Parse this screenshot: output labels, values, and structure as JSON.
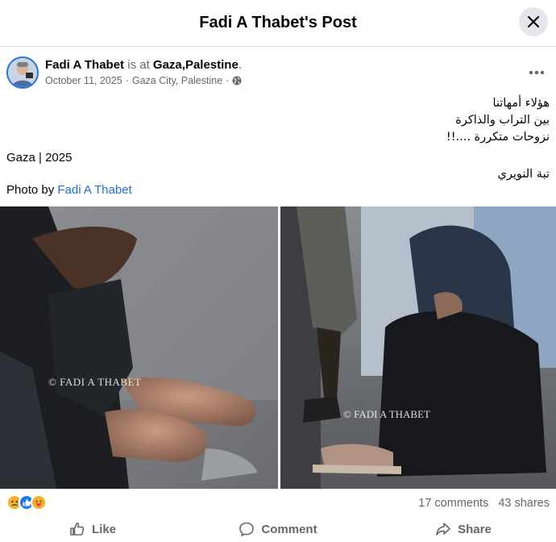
{
  "header": {
    "title": "Fadi A Thabet's Post",
    "close_icon": "close-icon"
  },
  "post": {
    "author": "Fadi A Thabet",
    "is_at": "is at",
    "location_name": "Gaza,Palestine",
    "period": ".",
    "date": "October 11, 2025",
    "separator": "·",
    "place": "Gaza City, Palestine",
    "privacy_icon": "globe-icon",
    "more_icon": "more-dots-icon",
    "arabic_lines": [
      "هؤلاء أمهاتنا",
      "بين التراب والذاكرة",
      "نزوحات متكررة ....!!",
      "تبة النويري"
    ],
    "caption": "Gaza | 2025",
    "photo_by_label": "Photo by",
    "photo_by_name": "Fadi A Thabet"
  },
  "photos": {
    "left_watermark": "© FADI A THABET",
    "right_watermark": "© FADI A THABET"
  },
  "stats": {
    "reaction_icons": [
      "sad-icon",
      "like-icon",
      "care-icon"
    ],
    "comments": "17 comments",
    "shares": "43 shares"
  },
  "actions": {
    "like": "Like",
    "comment": "Comment",
    "share": "Share"
  },
  "colors": {
    "accent": "#1b74e4",
    "link": "#216fdb",
    "muted": "#65676b"
  }
}
